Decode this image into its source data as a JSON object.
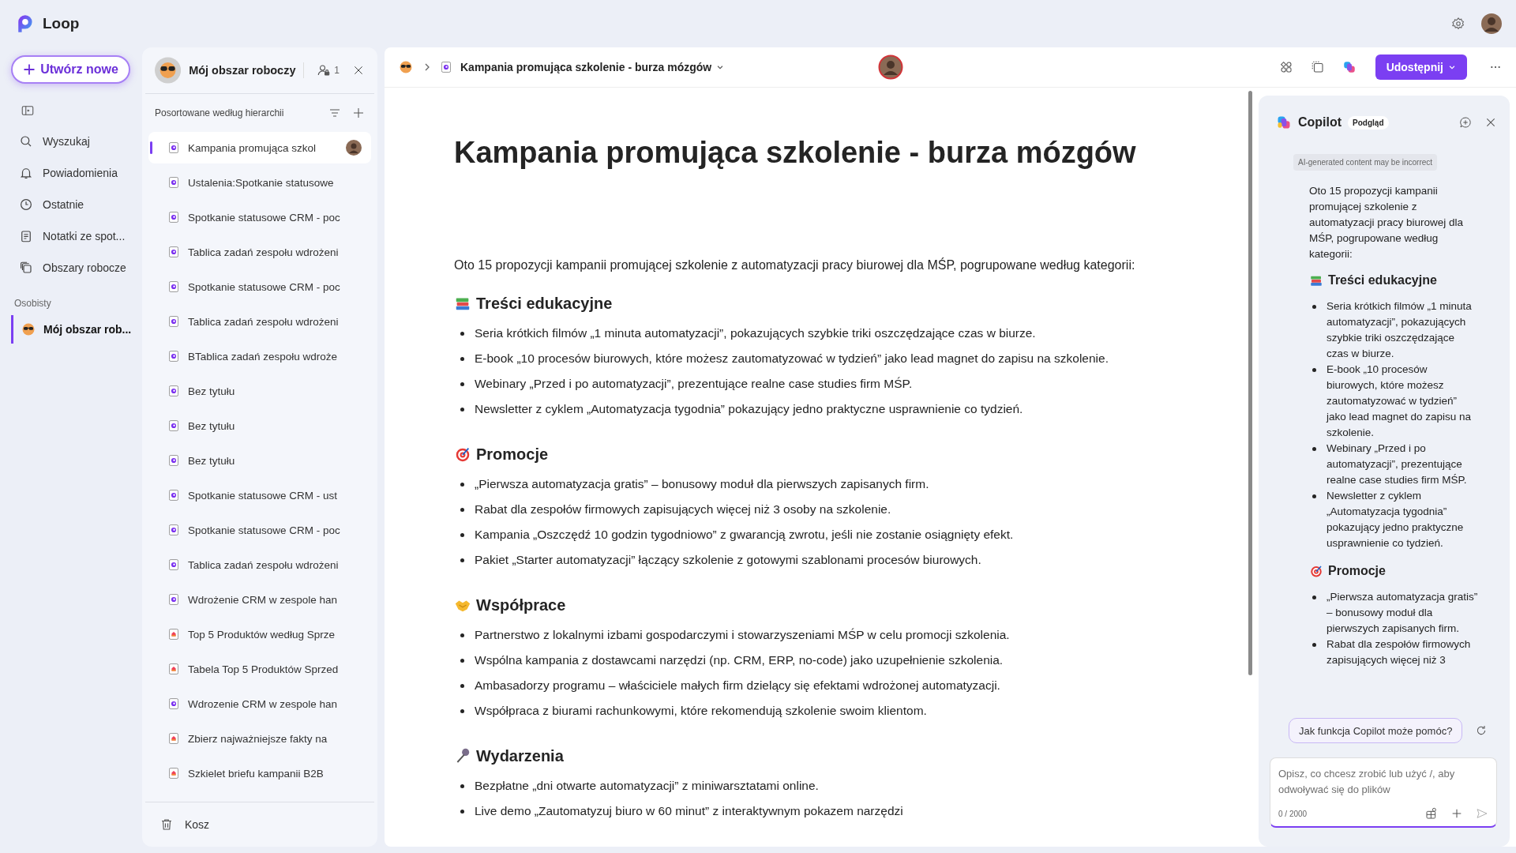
{
  "app": {
    "name": "Loop"
  },
  "create_button": "Utwórz nowe",
  "nav": [
    {
      "kind": "search",
      "label": "Wyszukaj"
    },
    {
      "kind": "bell",
      "label": "Powiadomienia"
    },
    {
      "kind": "clock",
      "label": "Ostatnie"
    },
    {
      "kind": "notes",
      "label": "Notatki ze spot..."
    },
    {
      "kind": "workspaces",
      "label": "Obszary robocze"
    }
  ],
  "personal": {
    "heading": "Osobisty",
    "items": [
      {
        "label": "Mój obszar rob...",
        "selected": true
      }
    ]
  },
  "workspace_panel": {
    "title": "Mój obszar roboczy",
    "members": "1",
    "sort_label": "Posortowane według hierarchii",
    "items": [
      {
        "kind": "loop",
        "label": "Kampania promująca szkol",
        "selected": true,
        "collaborator": true
      },
      {
        "kind": "loop",
        "label": "Ustalenia:Spotkanie statusowe",
        "selected": false,
        "collaborator": false
      },
      {
        "kind": "loop",
        "label": "Spotkanie statusowe CRM - poc",
        "selected": false,
        "collaborator": false
      },
      {
        "kind": "loop",
        "label": "Tablica zadań zespołu wdrożeni",
        "selected": false,
        "collaborator": false
      },
      {
        "kind": "loop",
        "label": "Spotkanie statusowe CRM - poc",
        "selected": false,
        "collaborator": false
      },
      {
        "kind": "loop",
        "label": "Tablica zadań zespołu wdrożeni",
        "selected": false,
        "collaborator": false
      },
      {
        "kind": "loop",
        "label": "BTablica zadań zespołu wdroże",
        "selected": false,
        "collaborator": false
      },
      {
        "kind": "loop",
        "label": "Bez tytułu",
        "selected": false,
        "collaborator": false
      },
      {
        "kind": "loop",
        "label": "Bez tytułu",
        "selected": false,
        "collaborator": false
      },
      {
        "kind": "loop",
        "label": "Bez tytułu",
        "selected": false,
        "collaborator": false
      },
      {
        "kind": "loop",
        "label": "Spotkanie statusowe CRM - ust",
        "selected": false,
        "collaborator": false
      },
      {
        "kind": "loop",
        "label": "Spotkanie statusowe CRM - poc",
        "selected": false,
        "collaborator": false
      },
      {
        "kind": "loop",
        "label": "Tablica zadań zespołu wdrożeni",
        "selected": false,
        "collaborator": false
      },
      {
        "kind": "loop",
        "label": "Wdrożenie CRM w zespole han",
        "selected": false,
        "collaborator": false
      },
      {
        "kind": "page",
        "label": "Top 5 Produktów według Sprze",
        "selected": false,
        "collaborator": false
      },
      {
        "kind": "page",
        "label": "Tabela Top 5 Produktów Sprzed",
        "selected": false,
        "collaborator": false
      },
      {
        "kind": "loop",
        "label": "Wdrozenie CRM w zespole han",
        "selected": false,
        "collaborator": false
      },
      {
        "kind": "page",
        "label": "Zbierz najważniejsze fakty na",
        "selected": false,
        "collaborator": false
      },
      {
        "kind": "page",
        "label": "Szkielet briefu kampanii B2B",
        "selected": false,
        "collaborator": false
      }
    ],
    "trash": "Kosz"
  },
  "header": {
    "page_title": "Kampania promująca szkolenie - burza mózgów",
    "share_button": "Udostępnij"
  },
  "document": {
    "title": "Kampania promująca szkolenie - burza mózgów",
    "intro": "Oto 15 propozycji kampanii promującej szkolenie z automatyzacji pracy biurowej dla MŚP, pogrupowane według kategorii:",
    "sections": [
      {
        "kind": "books",
        "heading": "Treści edukacyjne",
        "bullets": [
          "Seria krótkich filmów „1 minuta automatyzacji”, pokazujących szybkie triki oszczędzające czas w biurze.",
          "E-book „10 procesów biurowych, które możesz zautomatyzować w tydzień” jako lead magnet do zapisu na szkolenie.",
          "Webinary „Przed i po automatyzacji”, prezentujące realne case studies firm MŚP.",
          "Newsletter z cyklem „Automatyzacja tygodnia” pokazujący jedno praktyczne usprawnienie co tydzień."
        ]
      },
      {
        "kind": "target",
        "heading": "Promocje",
        "bullets": [
          "„Pierwsza automatyzacja gratis” – bonusowy moduł dla pierwszych zapisanych firm.",
          "Rabat dla zespołów firmowych zapisujących więcej niż 3 osoby na szkolenie.",
          "Kampania „Oszczędź 10 godzin tygodniowo” z gwarancją zwrotu, jeśli nie zostanie osiągnięty efekt.",
          "Pakiet „Starter automatyzacji” łączący szkolenie z gotowymi szablonami procesów biurowych."
        ]
      },
      {
        "kind": "handshake",
        "heading": "Współprace",
        "bullets": [
          "Partnerstwo z lokalnymi izbami gospodarczymi i stowarzyszeniami MŚP w celu promocji szkolenia.",
          "Wspólna kampania z dostawcami narzędzi (np. CRM, ERP, no-code) jako uzupełnienie szkolenia.",
          "Ambasadorzy programu – właściciele małych firm dzielący się efektami wdrożonej automatyzacji.",
          "Współpraca z biurami rachunkowymi, które rekomendują szkolenie swoim klientom."
        ]
      },
      {
        "kind": "microphone",
        "heading": "Wydarzenia",
        "bullets": [
          "Bezpłatne „dni otwarte automatyzacji” z miniwarsztatami online.",
          "Live demo „Zautomatyzuj biuro w 60 minut” z interaktywnym pokazem narzędzi"
        ]
      }
    ]
  },
  "copilot": {
    "title": "Copilot",
    "badge": "Podgląd",
    "disclaimer": "AI-generated content may be incorrect",
    "intro": "Oto 15 propozycji kampanii promującej szkolenie z automatyzacji pracy biurowej dla MŚP, pogrupowane według kategorii:",
    "sections": [
      {
        "kind": "books",
        "heading": "Treści edukacyjne",
        "bullets": [
          "Seria krótkich filmów „1 minuta automatyzacji”, pokazujących szybkie triki oszczędzające czas w biurze.",
          "E-book „10 procesów biurowych, które możesz zautomatyzować w tydzień” jako lead magnet do zapisu na szkolenie.",
          "Webinary „Przed i po automatyzacji”, prezentujące realne case studies firm MŚP.",
          "Newsletter z cyklem „Automatyzacja tygodnia” pokazujący jedno praktyczne usprawnienie co tydzień."
        ]
      },
      {
        "kind": "target",
        "heading": "Promocje",
        "bullets": [
          "„Pierwsza automatyzacja gratis” – bonusowy moduł dla pierwszych zapisanych firm.",
          "Rabat dla zespołów firmowych zapisujących więcej niż 3"
        ]
      }
    ],
    "suggestion": "Jak funkcja Copilot może pomóc?",
    "placeholder": "Opisz, co chcesz zrobić lub użyć /, aby odwoływać się do plików",
    "counter": "0 / 2000"
  }
}
